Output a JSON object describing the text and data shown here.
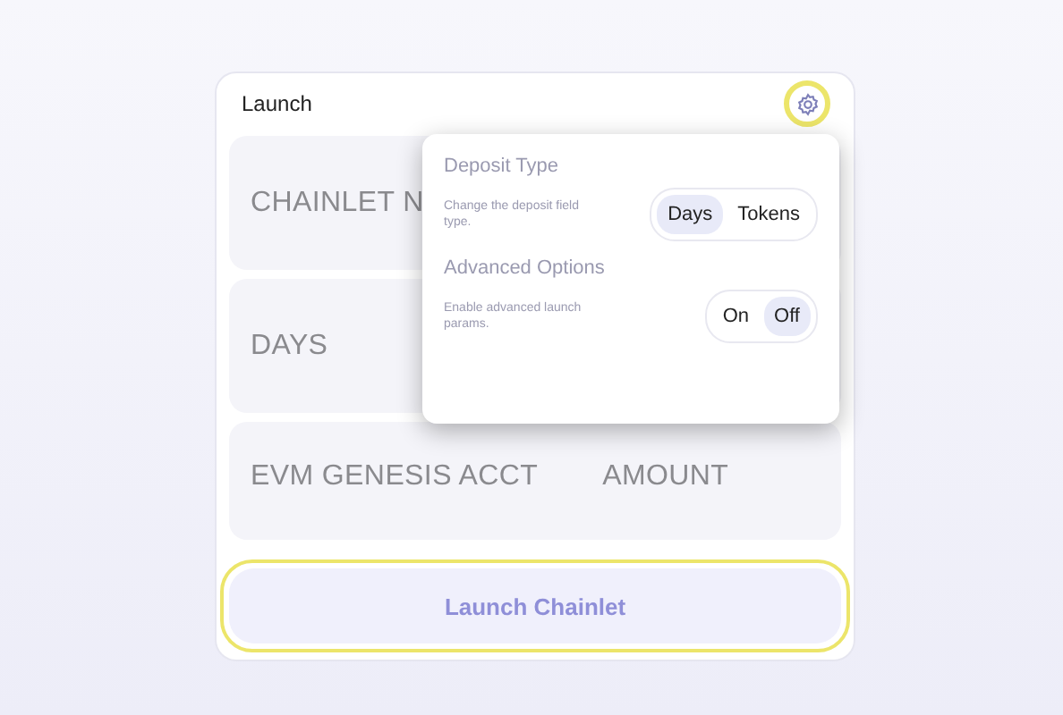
{
  "card": {
    "title": "Launch",
    "settings_highlighted": true
  },
  "fields": [
    {
      "labels": [
        "CHAINLET N"
      ]
    },
    {
      "labels": [
        "DAYS"
      ]
    },
    {
      "labels": [
        "EVM GENESIS ACCT",
        "AMOUNT"
      ]
    }
  ],
  "launch_button": {
    "label": "Launch Chainlet",
    "highlighted": true
  },
  "popover": {
    "sections": [
      {
        "title": "Deposit Type",
        "description": "Change the deposit field type.",
        "options": [
          {
            "label": "Days",
            "selected": true
          },
          {
            "label": "Tokens",
            "selected": false
          }
        ]
      },
      {
        "title": "Advanced Options",
        "description": "Enable advanced launch params.",
        "options": [
          {
            "label": "On",
            "selected": false
          },
          {
            "label": "Off",
            "selected": true
          }
        ]
      }
    ]
  }
}
